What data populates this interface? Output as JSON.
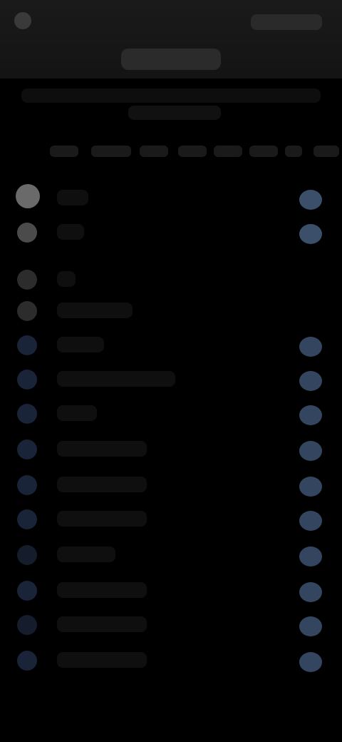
{
  "topbar": {
    "back_label": "",
    "action_label": "",
    "title": ""
  },
  "subtitle": {
    "line1": "",
    "line2": ""
  },
  "columns": [
    "",
    "",
    "",
    "",
    "",
    "",
    "",
    ""
  ],
  "rows": [
    {
      "label": ""
    },
    {
      "label": ""
    },
    {
      "label": ""
    },
    {
      "label": ""
    },
    {
      "label": ""
    },
    {
      "label": ""
    },
    {
      "label": ""
    },
    {
      "label": ""
    },
    {
      "label": ""
    },
    {
      "label": ""
    },
    {
      "label": ""
    },
    {
      "label": ""
    },
    {
      "label": ""
    },
    {
      "label": ""
    }
  ],
  "colors": {
    "background": "#000000",
    "topbar": "#1a1a1a",
    "accent_blue": "#3b4e6a",
    "row_icon_grey": "#2c2c2c",
    "row_icon_blue": "#1a2438"
  }
}
